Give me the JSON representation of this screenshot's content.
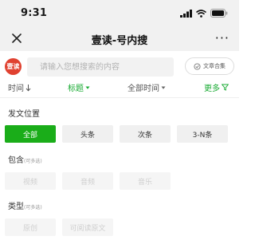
{
  "status": {
    "time": "9:31"
  },
  "nav": {
    "title": "壹读-号内搜",
    "more_label": "···"
  },
  "search": {
    "logo_text": "壹读",
    "placeholder": "请输入您想搜索的内容",
    "collection_label": "文章合集"
  },
  "sort": {
    "time_label": "时间",
    "title_label": "标题",
    "all_time_label": "全部时间",
    "more_label": "更多"
  },
  "filters": {
    "position": {
      "title": "发文位置",
      "options": [
        "全部",
        "头条",
        "次条",
        "3-N条"
      ],
      "selected": "全部"
    },
    "include": {
      "title": "包含",
      "note": "(可多选)",
      "options": [
        "视频",
        "音频",
        "音乐"
      ]
    },
    "type": {
      "title": "类型",
      "note": "(可多选)",
      "options": [
        "原创",
        "可阅读原文"
      ]
    }
  },
  "colors": {
    "accent": "#1aad19",
    "logo": "#e04130"
  }
}
